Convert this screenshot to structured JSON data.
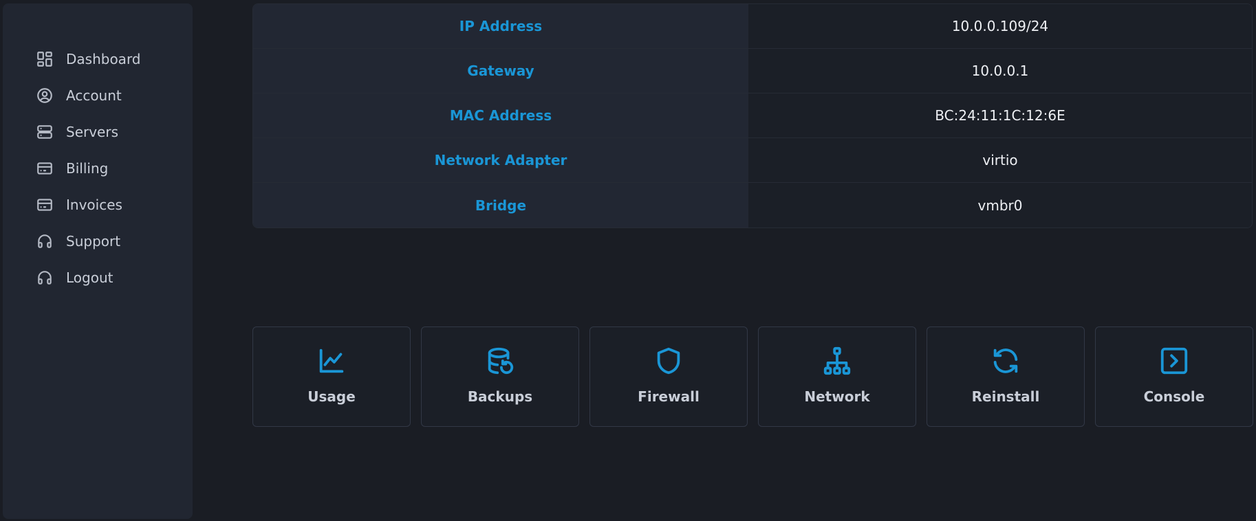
{
  "sidebar": {
    "items": [
      {
        "label": "Dashboard",
        "icon": "dashboard-icon"
      },
      {
        "label": "Account",
        "icon": "user-circle-icon"
      },
      {
        "label": "Servers",
        "icon": "server-icon"
      },
      {
        "label": "Billing",
        "icon": "credit-card-icon"
      },
      {
        "label": "Invoices",
        "icon": "credit-card-icon"
      },
      {
        "label": "Support",
        "icon": "headphones-icon"
      },
      {
        "label": "Logout",
        "icon": "headphones-icon"
      }
    ]
  },
  "network": {
    "rows": [
      {
        "label": "IP Address",
        "value": "10.0.0.109/24"
      },
      {
        "label": "Gateway",
        "value": "10.0.0.1"
      },
      {
        "label": "MAC Address",
        "value": "BC:24:11:1C:12:6E"
      },
      {
        "label": "Network Adapter",
        "value": "virtio"
      },
      {
        "label": "Bridge",
        "value": "vmbr0"
      }
    ]
  },
  "actions": [
    {
      "label": "Usage",
      "icon": "chart-line-icon"
    },
    {
      "label": "Backups",
      "icon": "database-restore-icon"
    },
    {
      "label": "Firewall",
      "icon": "shield-icon"
    },
    {
      "label": "Network",
      "icon": "network-icon"
    },
    {
      "label": "Reinstall",
      "icon": "refresh-icon"
    },
    {
      "label": "Console",
      "icon": "terminal-icon"
    }
  ],
  "colors": {
    "accent": "#1a96d6",
    "background": "#1a1d24",
    "sidebar": "#212631"
  }
}
